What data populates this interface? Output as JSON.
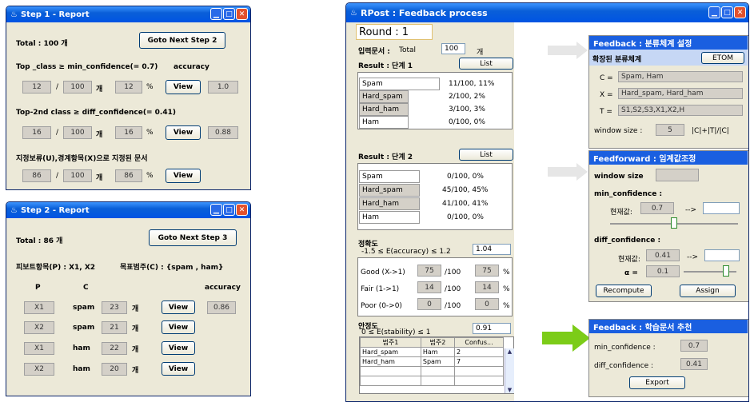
{
  "step1": {
    "title": "Step 1 - Report",
    "total": "Total : 100 개",
    "next_btn": "Goto Next Step 2",
    "top_class_cond": "Top _class ≥ min_confidence(= 0.7)",
    "accuracy_label": "accuracy",
    "r1": {
      "a": "12",
      "b": "100",
      "unit": "개",
      "pct": "12",
      "pct_unit": "%",
      "view": "View",
      "acc": "1.0"
    },
    "top2_cond": "Top-2nd class ≥ diff_confidence(= 0.41)",
    "r2": {
      "a": "16",
      "b": "100",
      "unit": "개",
      "pct": "16",
      "pct_unit": "%",
      "view": "View",
      "acc": "0.88"
    },
    "designated": "지정보류(U),경계항목(X)으로 지정된 문서",
    "r3": {
      "a": "86",
      "b": "100",
      "unit": "개",
      "pct": "86",
      "pct_unit": "%",
      "view": "View"
    },
    "slash": "/"
  },
  "step2": {
    "title": "Step 2 - Report",
    "total": "Total : 86 개",
    "next_btn": "Goto Next Step 3",
    "pivot": "피보트항목(P) : X1, X2",
    "target": "목표범주(C) : {spam , ham}",
    "col_p": "P",
    "col_c": "C",
    "col_acc": "accuracy",
    "rows": [
      {
        "p": "X1",
        "c": "spam",
        "n": "23",
        "unit": "개",
        "view": "View",
        "acc": "0.86"
      },
      {
        "p": "X2",
        "c": "spam",
        "n": "21",
        "unit": "개",
        "view": "View",
        "acc": ""
      },
      {
        "p": "X1",
        "c": "ham",
        "n": "22",
        "unit": "개",
        "view": "View",
        "acc": ""
      },
      {
        "p": "X2",
        "c": "ham",
        "n": "20",
        "unit": "개",
        "view": "View",
        "acc": ""
      }
    ]
  },
  "rpost": {
    "title": "RPost : Feedback process",
    "round": "Round : 1",
    "input_label": "입력문서 :",
    "total_label": "Total",
    "total_val": "100",
    "total_unit": "개",
    "result1_label": "Result : 단계 1",
    "list_btn": "List",
    "result1": [
      {
        "name": "Spam",
        "val": "11/100, 11%"
      },
      {
        "name": "Hard_spam",
        "val": "2/100,  2%"
      },
      {
        "name": "Hard_ham",
        "val": "3/100,  3%"
      },
      {
        "name": "Ham",
        "val": "0/100,  0%"
      }
    ],
    "result2_label": "Result : 단계 2",
    "result2": [
      {
        "name": "Spam",
        "val": "0/100,  0%"
      },
      {
        "name": "Hard_spam",
        "val": "45/100, 45%"
      },
      {
        "name": "Hard_ham",
        "val": "41/100, 41%"
      },
      {
        "name": "Ham",
        "val": "0/100,  0%"
      }
    ],
    "accuracy_title": "정확도",
    "accuracy_range": "-1.5 ≤ E(accuracy) ≤ 1.2",
    "accuracy_val": "1.04",
    "acc_rows": [
      {
        "label": "Good (X->1)",
        "a": "75",
        "den": "/100",
        "p": "75",
        "unit": "%"
      },
      {
        "label": "Fair (1->1)",
        "a": "14",
        "den": "/100",
        "p": "14",
        "unit": "%"
      },
      {
        "label": "Poor (0->0)",
        "a": "0",
        "den": "/100",
        "p": "0",
        "unit": "%"
      }
    ],
    "stability_title": "안정도",
    "stability_range": "0 ≤ E(stability) ≤ 1",
    "stability_val": "0.91",
    "table_headers": [
      "범주1",
      "범주2",
      "Confus..."
    ],
    "table_rows": [
      [
        "Hard_spam",
        "Ham",
        "2"
      ],
      [
        "Hard_ham",
        "Spam",
        "7"
      ]
    ]
  },
  "feedback1": {
    "title": "Feedback : 분류체계 설정",
    "subtitle": "확장된 분류체계",
    "etom": "ETOM",
    "c_label": "C =",
    "c_val": "Spam, Ham",
    "x_label": "X =",
    "x_val": "Hard_spam, Hard_ham",
    "t_label": "T =",
    "t_val": "S1,S2,S3,X1,X2,H",
    "window_label": "window size :",
    "window_val": "5",
    "window_formula": "|C|+|T|/|C|"
  },
  "feedforward": {
    "title": "Feedforward : 임계값조정",
    "window_size": "window size",
    "min_conf": "min_confidence :",
    "current": "현재값:",
    "min_val": "0.7",
    "arrow": "-->",
    "diff_conf": "diff_confidence :",
    "diff_val": "0.41",
    "alpha": "α =",
    "alpha_val": "0.1",
    "recompute": "Recompute",
    "assign": "Assign",
    "min_slider_level": 0.5,
    "alpha_slider_level": 0.8
  },
  "feedback2": {
    "title": "Feedback : 학습문서 추천",
    "min_conf": "min_confidence :",
    "min_val": "0.7",
    "diff_conf": "diff_confidence  :",
    "diff_val": "0.41",
    "export": "Export"
  },
  "colors": {
    "titlebar": "#0054e3",
    "panel_head": "#1a5fe0",
    "arrow_green": "#7ccc18",
    "arrow_gray": "#e6e6e6"
  }
}
